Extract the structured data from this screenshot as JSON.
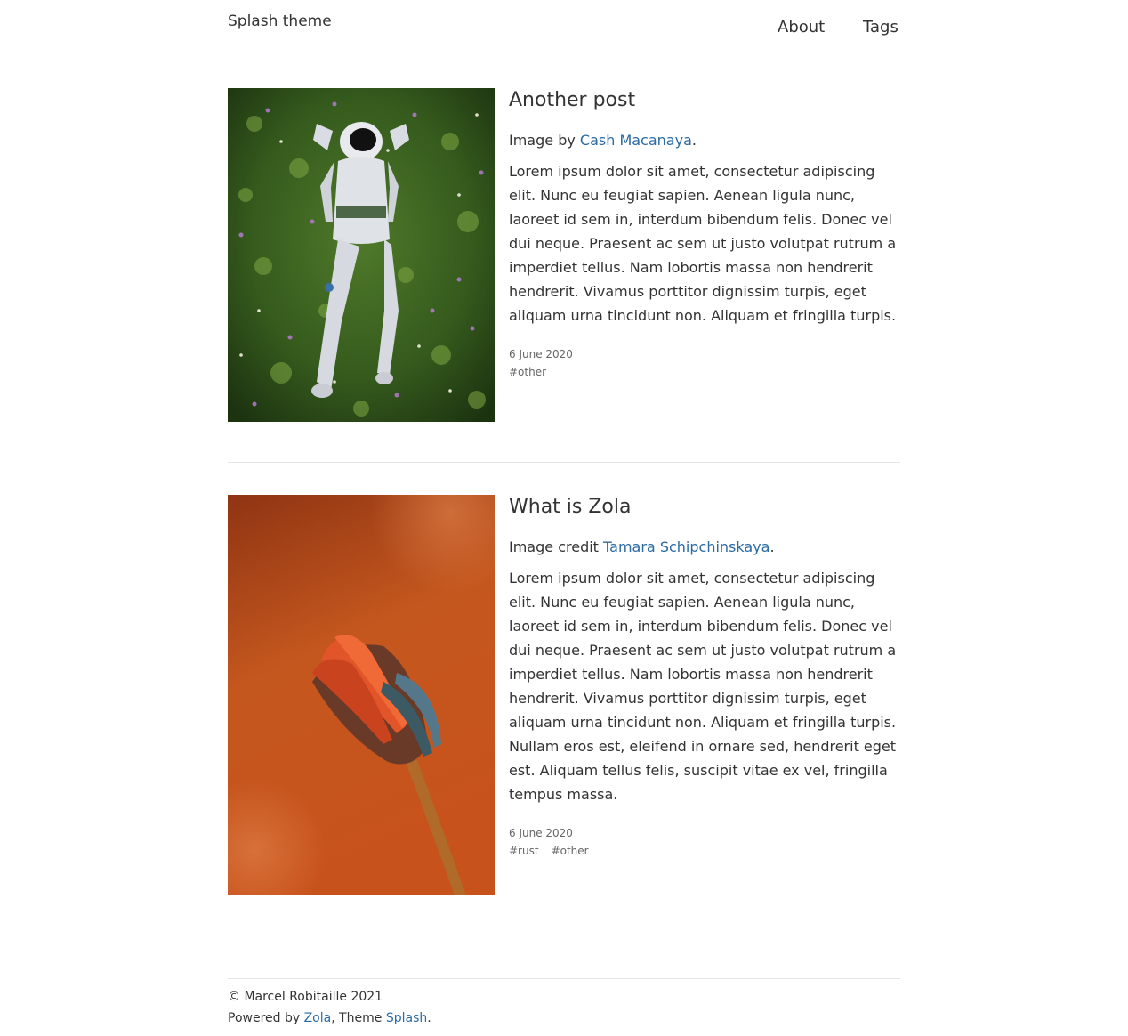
{
  "site": {
    "title": "Splash theme"
  },
  "nav": {
    "about": "About",
    "tags": "Tags"
  },
  "posts": [
    {
      "title": "Another post",
      "credit_prefix": "Image by ",
      "credit_name": "Cash Macanaya",
      "credit_suffix": ".",
      "body": "Lorem ipsum dolor sit amet, consectetur adipiscing elit. Nunc eu feugiat sapien. Aenean ligula nunc, laoreet id sem in, interdum bibendum felis. Donec vel dui neque. Praesent ac sem ut justo volutpat rutrum a imperdiet tellus. Nam lobortis massa non hendrerit hendrerit. Vivamus porttitor dignissim turpis, eget aliquam urna tincidunt non. Aliquam et fringilla turpis.",
      "date": "6 June 2020",
      "tags": [
        "#other"
      ],
      "image": "astronaut-lying-in-flower-field-photo"
    },
    {
      "title": "What is Zola",
      "credit_prefix": "Image credit ",
      "credit_name": "Tamara Schipchinskaya",
      "credit_suffix": ".",
      "body": "Lorem ipsum dolor sit amet, consectetur adipiscing elit. Nunc eu feugiat sapien. Aenean ligula nunc, laoreet id sem in, interdum bibendum felis. Donec vel dui neque. Praesent ac sem ut justo volutpat rutrum a imperdiet tellus. Nam lobortis massa non hendrerit hendrerit. Vivamus porttitor dignissim turpis, eget aliquam urna tincidunt non. Aliquam et fringilla turpis. Nullam eros est, eleifend in ornare sed, hendrerit eget est. Aliquam tellus felis, suscipit vitae ex vel, fringilla tempus massa.",
      "date": "6 June 2020",
      "tags": [
        "#rust",
        "#other"
      ],
      "image": "protea-flower-on-orange-background-photo"
    }
  ],
  "footer": {
    "copyright": "© Marcel Robitaille 2021",
    "powered_prefix": "Powered by ",
    "zola": "Zola",
    "theme_text": ", Theme ",
    "splash": "Splash",
    "end": "."
  },
  "colors": {
    "link": "#2b6aa3",
    "text": "#333333",
    "meta": "#666666",
    "separator": "#e5e5e5"
  }
}
